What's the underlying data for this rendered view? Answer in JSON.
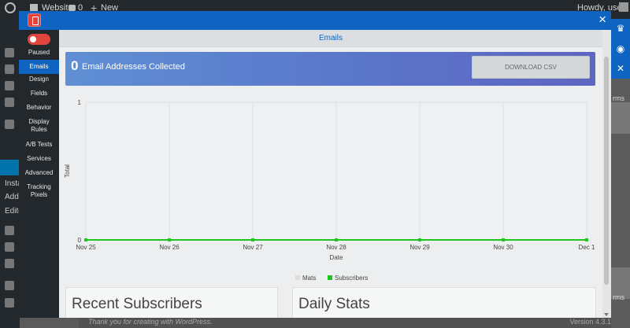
{
  "wp": {
    "site_name": "Website",
    "comment_count": "0",
    "new_label": "New",
    "greeting": "Howdy, user",
    "sub_items": [
      "Insta",
      "Add",
      "Edito"
    ],
    "footer_text": "Thank you for creating with WordPress.",
    "footer_version": "Version 4.3.1",
    "right_partial": "rms"
  },
  "modal": {
    "close_icon": "×",
    "toggle_label": "Paused",
    "nav": [
      {
        "label": "Emails"
      },
      {
        "label": "Design"
      },
      {
        "label": "Fields"
      },
      {
        "label": "Behavior"
      },
      {
        "label": "Display Rules"
      },
      {
        "label": "A/B Tests"
      },
      {
        "label": "Services"
      },
      {
        "label": "Advanced"
      },
      {
        "label": "Tracking Pixels"
      }
    ]
  },
  "page": {
    "title": "Emails",
    "count": "0",
    "count_label": "Email Addresses Collected",
    "download_label": "DOWNLOAD CSV",
    "recent_title": "Recent Subscribers",
    "daily_title": "Daily Stats"
  },
  "chart_data": {
    "type": "line",
    "x": [
      "Nov 25",
      "Nov 26",
      "Nov 27",
      "Nov 28",
      "Nov 29",
      "Nov 30",
      "Dec 1"
    ],
    "series": [
      {
        "name": "Mats",
        "values": [
          0,
          0,
          0,
          0,
          0,
          0,
          0
        ],
        "color": "#dddddd"
      },
      {
        "name": "Subscribers",
        "values": [
          0,
          0,
          0,
          0,
          0,
          0,
          0
        ],
        "color": "#1ec51e"
      }
    ],
    "ylim": [
      0,
      1
    ],
    "yticks": [
      "0",
      "1"
    ],
    "xlabel": "Date",
    "ylabel": "Total",
    "grid": true,
    "legend": "bottom"
  },
  "colors": {
    "brand": "#0e64c0",
    "paused": "#e0443c",
    "series_line": "#1ec51e"
  },
  "tools": [
    {
      "icon": "crown-icon",
      "glyph": "♛"
    },
    {
      "icon": "globe-icon",
      "glyph": "◉"
    },
    {
      "icon": "close-icon",
      "glyph": "✕"
    }
  ]
}
